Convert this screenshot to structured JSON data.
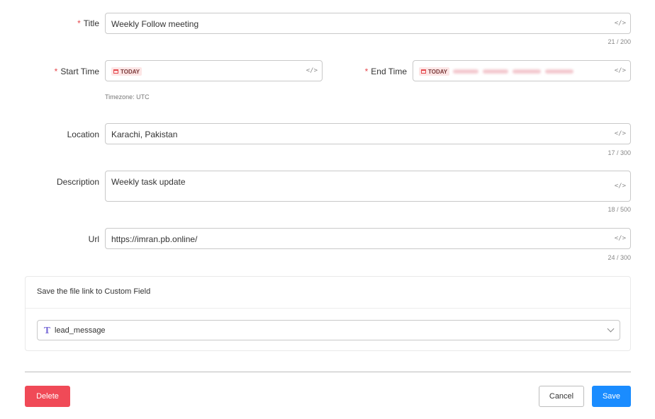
{
  "form": {
    "title": {
      "label": "Title",
      "required": "*",
      "value": "Weekly Follow meeting",
      "counter": "21 / 200"
    },
    "start_time": {
      "label": "Start Time",
      "required": "*",
      "chip": "TODAY"
    },
    "end_time": {
      "label": "End Time",
      "required": "*",
      "chip": "TODAY"
    },
    "timezone": "Timezone: UTC",
    "location": {
      "label": "Location",
      "value": "Karachi, Pakistan",
      "counter": "17 / 300"
    },
    "description": {
      "label": "Description",
      "value": "Weekly task update",
      "counter": "18 / 500"
    },
    "url": {
      "label": "Url",
      "value": "https://imran.pb.online/",
      "counter": "24 / 300"
    },
    "code_icon": "</>"
  },
  "custom_field": {
    "heading": "Save the file link to Custom Field",
    "select_icon": "T",
    "select_value": "lead_message"
  },
  "actions": {
    "delete": "Delete",
    "cancel": "Cancel",
    "save": "Save"
  },
  "colors": {
    "required": "#e5484d",
    "delete": "#f04a57",
    "save": "#1a8cff",
    "chip_bg": "#fde6e6"
  }
}
